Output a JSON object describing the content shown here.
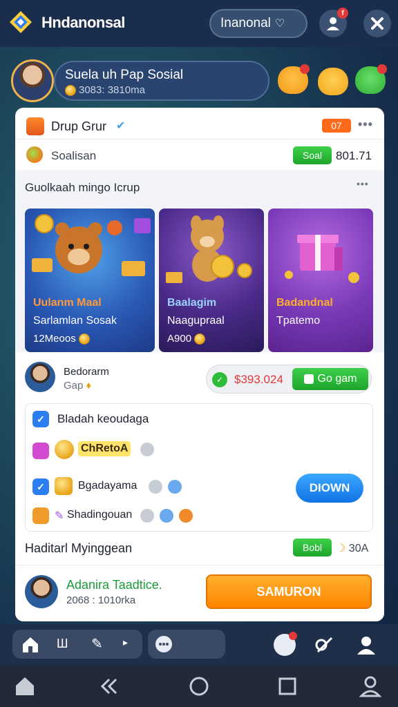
{
  "header": {
    "app_title": "Hndanonsal",
    "pill_label": "Inanonal",
    "notif_badge": "f"
  },
  "profile": {
    "name": "Suela uh Pap Sosial",
    "sub": "3083: 3810ma"
  },
  "card": {
    "group_title": "Drup Grur",
    "group_tag": "07",
    "subtitle": "Soalisan",
    "badge_label": "Soal",
    "badge_value": "801.71",
    "section_title": "Guolkaah mingo Icrup",
    "tiles": [
      {
        "title": "Uulanm Maal",
        "line2": "Sarlamlan Sosak",
        "amount": "12Meoos"
      },
      {
        "title": "Baalagim",
        "line2": "Naagupraal",
        "amount": "A900"
      },
      {
        "title": "Badandnal",
        "line2": "Tpatemo",
        "amount": ""
      }
    ],
    "seller": {
      "name": "Bedorarm",
      "sub": "Gap"
    },
    "price": "$393.024",
    "go_label": "Go gam",
    "list_title": "Bladah keoudaga",
    "list_items": [
      {
        "label": "ChRetoA"
      },
      {
        "label": "Bgadayama"
      },
      {
        "label": "Shadingouan"
      }
    ],
    "down_label": "DIOWN",
    "footer_heading": "Haditarl Myinggean",
    "footer_badge": "Bobl",
    "footer_value": "30A",
    "bottom_name": "Adanira Taadtice.",
    "bottom_sub": "2068 : 1010rka",
    "cta_label": "SAMURON"
  },
  "toolbar": {
    "item_label": "Ш"
  },
  "colors": {
    "accent_green": "#1da52b",
    "accent_orange": "#ff8500",
    "accent_blue": "#1173e4",
    "header_bg": "#1b2d4d"
  }
}
